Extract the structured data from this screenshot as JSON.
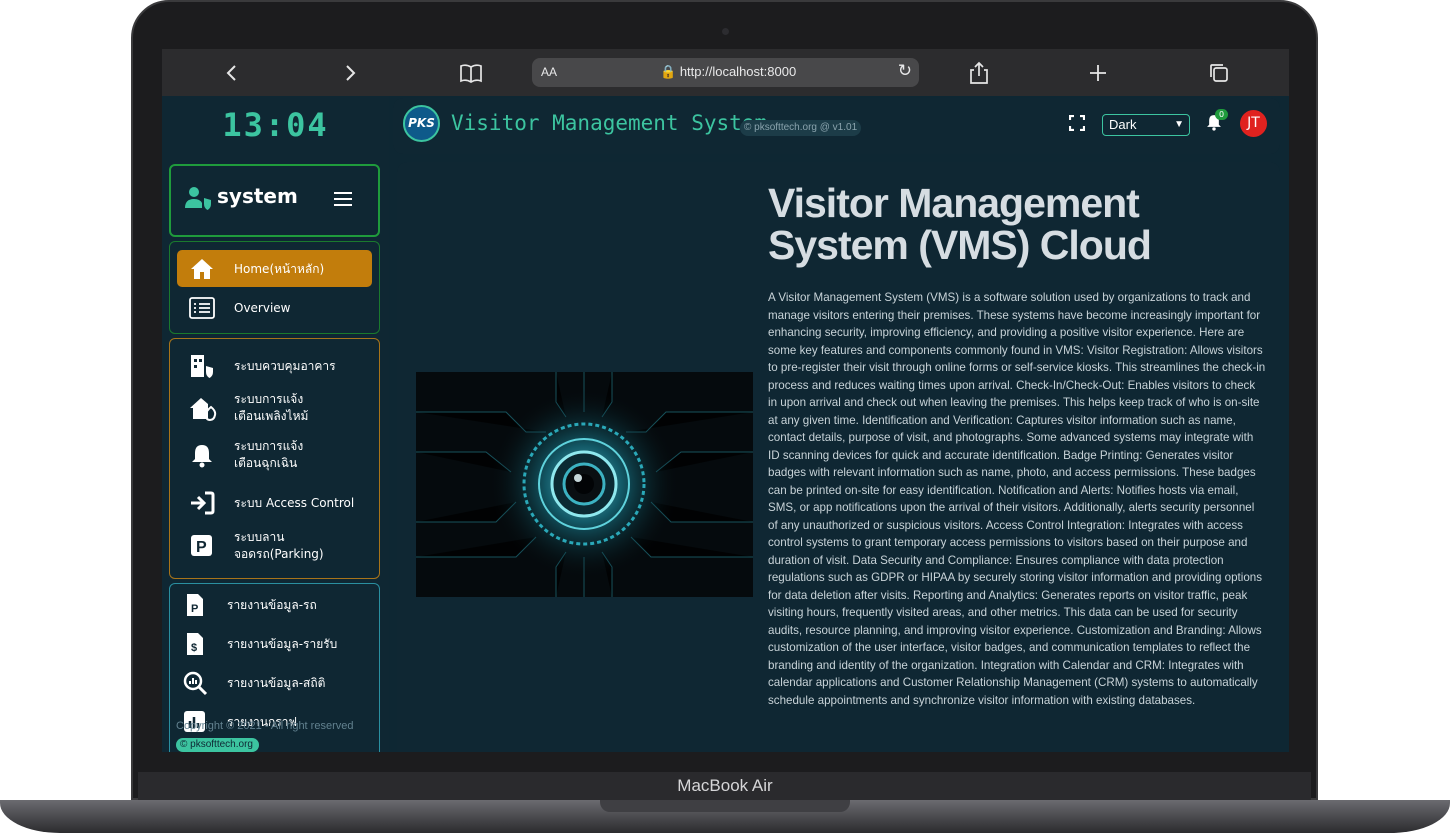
{
  "device": {
    "label": "MacBook Air"
  },
  "browser": {
    "aa_label": "AA",
    "url": "http://localhost:8000",
    "back_icon": "chevron-left-icon",
    "forward_icon": "chevron-right-icon",
    "bookmarks_icon": "book-icon",
    "share_icon": "share-icon",
    "new_tab_icon": "plus-icon",
    "tabs_icon": "tabs-icon"
  },
  "sidebar": {
    "clock": "13:04",
    "brand": "system",
    "nav_main": [
      {
        "label": "Home(หน้าหลัก)",
        "icon": "home-icon",
        "active": true
      },
      {
        "label": "Overview",
        "icon": "list-icon",
        "active": false
      }
    ],
    "nav_systems": [
      {
        "label": "ระบบควบคุมอาคาร",
        "icon": "building-shield-icon"
      },
      {
        "label": "ระบบการแจ้ง\nเตือนเพลิงไหม้",
        "icon": "house-fire-icon"
      },
      {
        "label": "ระบบการแจ้ง\nเตือนฉุกเฉิน",
        "icon": "bell-icon"
      },
      {
        "label": "ระบบ Access Control",
        "icon": "sign-in-icon"
      },
      {
        "label": "ระบบลาน\nจอดรถ(Parking)",
        "icon": "parking-icon"
      }
    ],
    "nav_reports": [
      {
        "label": "รายงานข้อมูล-รถ",
        "icon": "file-p-icon"
      },
      {
        "label": "รายงานข้อมูล-รายรับ",
        "icon": "file-dollar-icon"
      },
      {
        "label": "รายงานข้อมูล-สถิติ",
        "icon": "search-chart-icon"
      },
      {
        "label": "รายงานกราฟ",
        "icon": "bar-chart-icon"
      }
    ],
    "copyright": "Copyright © 2021 - All right reserved",
    "copyright_tag": "pksofttech.org"
  },
  "topbar": {
    "logo_text": "PKS",
    "title": "Visitor Management System",
    "domain_tag": "pksofttech.org  @ v1.01",
    "theme_value": "Dark",
    "notification_count": "0",
    "avatar_initials": "JT",
    "colors": {
      "accent": "#3cc4a0",
      "active_nav": "#c27d0c",
      "avatar": "#e0221f"
    }
  },
  "content": {
    "title": "Visitor Management System (VMS) Cloud",
    "body": "A Visitor Management System (VMS) is a software solution used by organizations to track and manage visitors entering their premises. These systems have become increasingly important for enhancing security, improving efficiency, and providing a positive visitor experience. Here are some key features and components commonly found in VMS: Visitor Registration: Allows visitors to pre-register their visit through online forms or self-service kiosks. This streamlines the check-in process and reduces waiting times upon arrival. Check-In/Check-Out: Enables visitors to check in upon arrival and check out when leaving the premises. This helps keep track of who is on-site at any given time. Identification and Verification: Captures visitor information such as name, contact details, purpose of visit, and photographs. Some advanced systems may integrate with ID scanning devices for quick and accurate identification. Badge Printing: Generates visitor badges with relevant information such as name, photo, and access permissions. These badges can be printed on-site for easy identification. Notification and Alerts: Notifies hosts via email, SMS, or app notifications upon the arrival of their visitors. Additionally, alerts security personnel of any unauthorized or suspicious visitors. Access Control Integration: Integrates with access control systems to grant temporary access permissions to visitors based on their purpose and duration of visit. Data Security and Compliance: Ensures compliance with data protection regulations such as GDPR or HIPAA by securely storing visitor information and providing options for data deletion after visits. Reporting and Analytics: Generates reports on visitor traffic, peak visiting hours, frequently visited areas, and other metrics. This data can be used for security audits, resource planning, and improving visitor experience. Customization and Branding: Allows customization of the user interface, visitor badges, and communication templates to reflect the branding and identity of the organization. Integration with Calendar and CRM: Integrates with calendar applications and Customer Relationship Management (CRM) systems to automatically schedule appointments and synchronize visitor information with existing databases."
  }
}
